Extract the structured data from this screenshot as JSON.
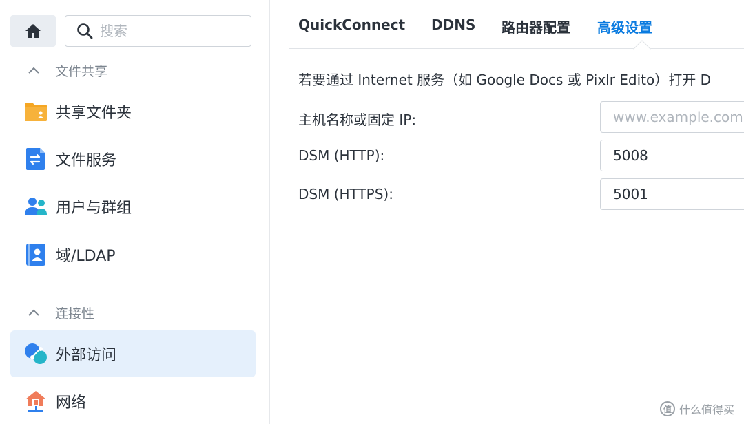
{
  "sidebar": {
    "search": {
      "placeholder": "搜索"
    },
    "sections": [
      {
        "label": "文件共享"
      },
      {
        "label": "连接性"
      }
    ],
    "items": [
      {
        "label": "共享文件夹",
        "icon": "folder-share-icon"
      },
      {
        "label": "文件服务",
        "icon": "file-services-icon"
      },
      {
        "label": "用户与群组",
        "icon": "users-icon"
      },
      {
        "label": "域/LDAP",
        "icon": "ldap-icon"
      },
      {
        "label": "外部访问",
        "icon": "external-access-icon"
      },
      {
        "label": "网络",
        "icon": "network-icon"
      }
    ]
  },
  "tabs": [
    {
      "label": "QuickConnect"
    },
    {
      "label": "DDNS"
    },
    {
      "label": "路由器配置"
    },
    {
      "label": "高级设置",
      "active": true
    }
  ],
  "main": {
    "description": "若要通过 Internet 服务（如 Google Docs 或 Pixlr Edito）打开 D",
    "fields": [
      {
        "label": "主机名称或固定 IP:",
        "value": "",
        "placeholder": "www.example.com"
      },
      {
        "label": "DSM (HTTP):",
        "value": "5008",
        "placeholder": ""
      },
      {
        "label": "DSM (HTTPS):",
        "value": "5001",
        "placeholder": ""
      }
    ]
  },
  "watermark": {
    "text": "什么值得买",
    "mark": "值"
  },
  "colors": {
    "accent": "#0a7be0",
    "active_bg": "#e5f0fc",
    "folder": "#f5a623",
    "blue_icon": "#2f80ed",
    "teal": "#25b5c9"
  }
}
